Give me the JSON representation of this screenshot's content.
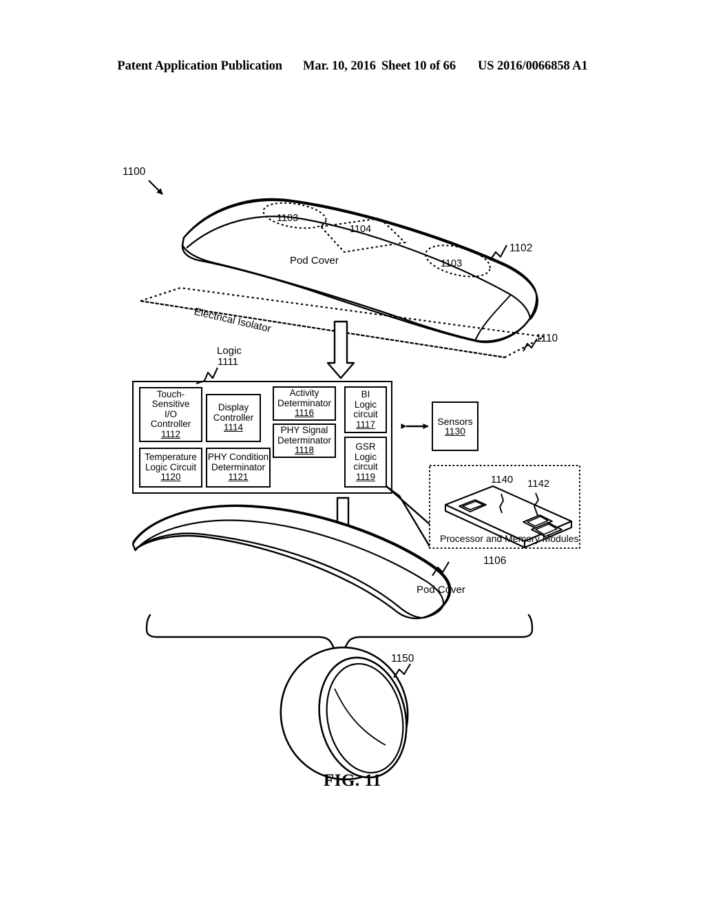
{
  "header": {
    "publication": "Patent Application Publication",
    "date": "Mar. 10, 2016",
    "sheet": "Sheet 10 of 66",
    "docnum": "US 2016/0066858 A1"
  },
  "figure": {
    "caption": "FIG. 11",
    "overall_ref": "1100"
  },
  "top_pod": {
    "label": "Pod Cover",
    "ref": "1102",
    "region_a_ref": "1103",
    "region_b_ref": "1104",
    "region_c_ref": "1103"
  },
  "isolator": {
    "label": "Electrical Isolator",
    "ref": "1110"
  },
  "logic": {
    "label": "Logic",
    "ref": "1111",
    "blocks": [
      {
        "name": "touch-sensitive-io-controller",
        "lines": [
          "Touch-",
          "Sensitive",
          "I/O",
          "Controller"
        ],
        "num": "1112"
      },
      {
        "name": "display-controller",
        "lines": [
          "Display",
          "Controller"
        ],
        "num": "1114"
      },
      {
        "name": "activity-determinator",
        "lines": [
          "Activity",
          "Determinator"
        ],
        "num": "1116"
      },
      {
        "name": "bi-logic-circuit",
        "lines": [
          "BI",
          "Logic",
          "circuit"
        ],
        "num": "1117"
      },
      {
        "name": "phy-signal-determinator",
        "lines": [
          "PHY Signal",
          "Determinator"
        ],
        "num": "1118"
      },
      {
        "name": "gsr-logic-circuit",
        "lines": [
          "GSR",
          "Logic",
          "circuit"
        ],
        "num": "1119"
      },
      {
        "name": "temperature-logic-circuit",
        "lines": [
          "Temperature",
          "Logic Circuit"
        ],
        "num": "1120"
      },
      {
        "name": "phy-condition-determinator",
        "lines": [
          "PHY Condition",
          "Determinator"
        ],
        "num": "1121"
      }
    ]
  },
  "sensors": {
    "label": "Sensors",
    "num": "1130"
  },
  "processor_panel": {
    "caption": "Processor and Memory Modules",
    "ref_board": "1140",
    "ref_chip": "1142"
  },
  "bottom_pod": {
    "label": "Pod Cover",
    "ref": "1106"
  },
  "ring": {
    "ref": "1150"
  },
  "colors": {
    "ink": "#000000",
    "paper": "#ffffff"
  }
}
